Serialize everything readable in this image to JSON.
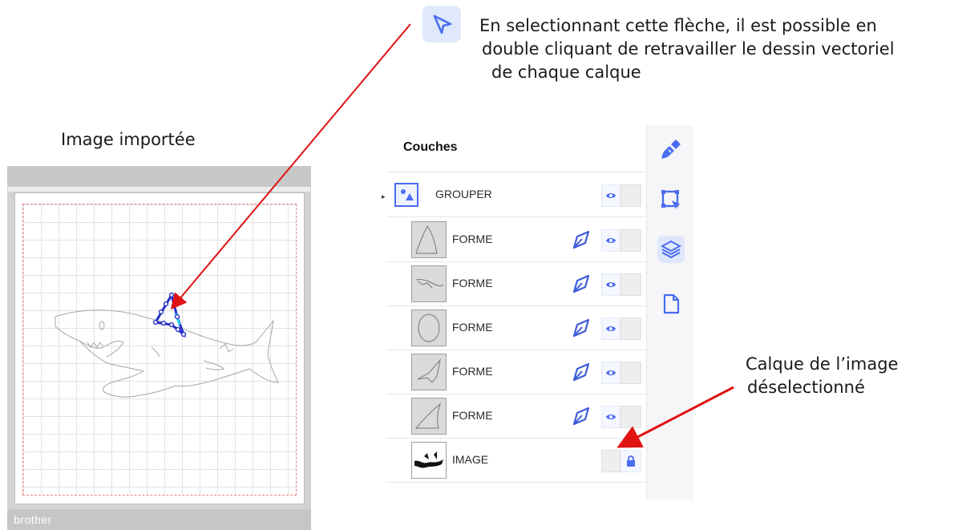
{
  "annotations": {
    "imported": "Image importée",
    "arrow_line1": "En selectionnant cette flèche, il est possible en",
    "arrow_line2": "double cliquant de retravailler le dessin vectoriel",
    "arrow_line3": "de chaque calque",
    "layer_line1": "Calque de l’image",
    "layer_line2": "déselectionné"
  },
  "mat": {
    "brand": "brother"
  },
  "panel": {
    "title": "Couches",
    "rows": [
      {
        "label": "GROUPER",
        "kind": "group",
        "visible": true,
        "locked": false
      },
      {
        "label": "FORME",
        "kind": "shape",
        "visible": true,
        "locked": false
      },
      {
        "label": "FORME",
        "kind": "shape",
        "visible": true,
        "locked": false
      },
      {
        "label": "FORME",
        "kind": "shape",
        "visible": true,
        "locked": false
      },
      {
        "label": "FORME",
        "kind": "shape",
        "visible": true,
        "locked": false
      },
      {
        "label": "FORME",
        "kind": "shape",
        "visible": true,
        "locked": false
      },
      {
        "label": "IMAGE",
        "kind": "image",
        "visible": false,
        "locked": true
      }
    ]
  },
  "sidebar": {
    "items": [
      "brush-icon",
      "select-edit-icon",
      "layers-icon",
      "page-icon"
    ],
    "active": "layers-icon"
  },
  "colors": {
    "accent": "#3d5bd9",
    "arrow_red": "#e01212",
    "panel_icon": "#4a6cf0"
  }
}
